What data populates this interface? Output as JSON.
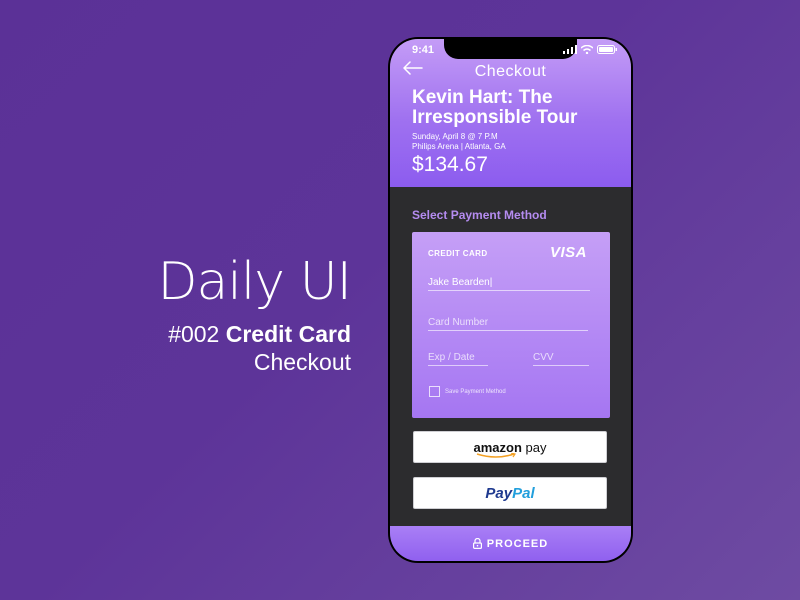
{
  "promo": {
    "title": "Daily UI",
    "number": "#002",
    "subtitle_line1": "Credit Card",
    "subtitle_line2": "Checkout"
  },
  "status_bar": {
    "time": "9:41"
  },
  "header": {
    "nav_title": "Checkout",
    "event_title_line1": "Kevin Hart: The",
    "event_title_line2": "Irresponsible Tour",
    "date": "Sunday, April 8 @ 7 P.M",
    "venue": "Philips Arena | Atlanta, GA",
    "price": "$134.67"
  },
  "payment": {
    "section_title": "Select Payment Method",
    "card": {
      "label": "CREDIT CARD",
      "brand": "VISA",
      "name_value": "Jake Bearden|",
      "number_placeholder": "Card Number",
      "exp_placeholder": "Exp / Date",
      "cvv_placeholder": "CVV",
      "save_label": "Save Payment Method"
    },
    "amazon": {
      "bold": "amazon",
      "rest": " pay"
    },
    "paypal": {
      "part1": "Pay",
      "part2": "Pal"
    }
  },
  "proceed_label": "PROCEED",
  "colors": {
    "background": "#5b3197",
    "accent": "#a576f2",
    "screen_dark": "#2c2c2e",
    "section_title": "#b58cf0"
  }
}
